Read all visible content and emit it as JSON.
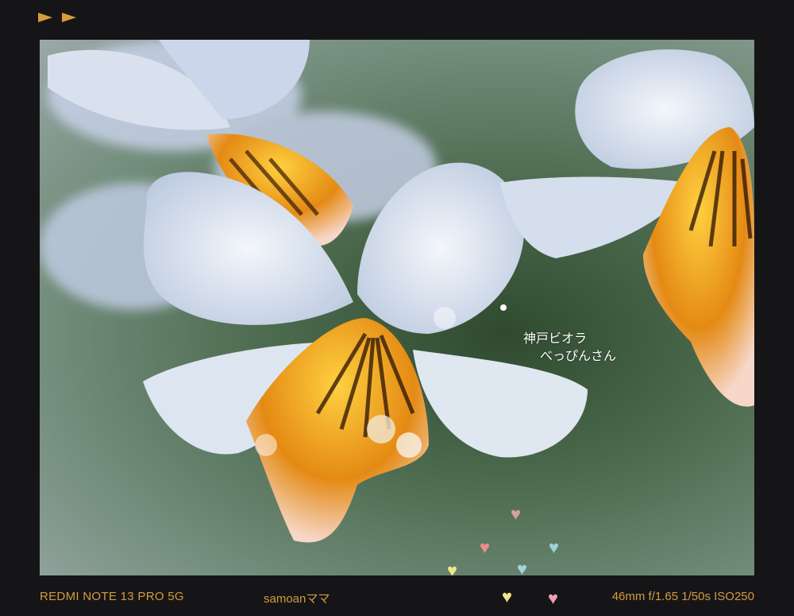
{
  "caption": {
    "line1": "神戸ビオラ",
    "line2": "べっぴんさん"
  },
  "footer": {
    "camera_model": "REDMI NOTE 13 PRO 5G",
    "photographer": "samoanママ",
    "exif": "46mm  f/1.65  1/50s  ISO250"
  },
  "colors": {
    "frame": "#151517",
    "footer_text": "#d69a3f",
    "petal": "#e6edf4",
    "flower_center": "#f2a41e"
  },
  "icons": {
    "heart": "♥"
  }
}
